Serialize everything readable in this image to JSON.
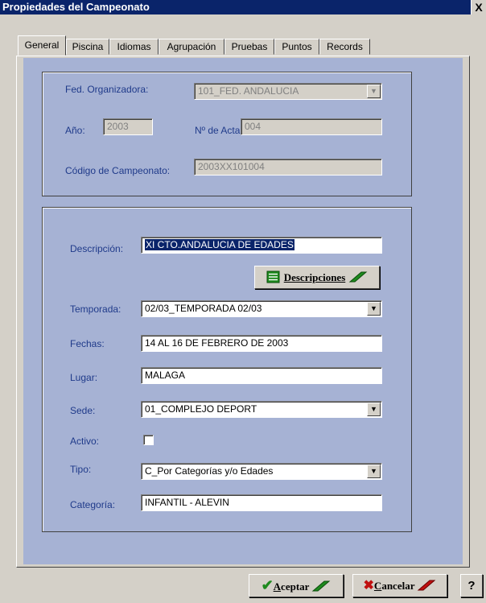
{
  "window": {
    "title": "Propiedades del Campeonato",
    "close": "X"
  },
  "tabs": [
    "General",
    "Piscina",
    "Idiomas",
    "Agrupación",
    "Pruebas",
    "Puntos",
    "Records"
  ],
  "top": {
    "fed_label": "Fed. Organizadora:",
    "fed_value": "101_FED. ANDALUCIA",
    "anio_label": "Año:",
    "anio_value": "2003",
    "acta_label": "Nº de Acta:",
    "acta_value": "004",
    "codigo_label": "Código de Campeonato:",
    "codigo_value": "2003XX101004"
  },
  "main": {
    "descripcion_label": "Descripción:",
    "descripcion_value": "XI CTO.ANDALUCIA DE EDADES",
    "descripciones_button": "Descripciones",
    "temporada_label": "Temporada:",
    "temporada_value": "02/03_TEMPORADA 02/03",
    "fechas_label": "Fechas:",
    "fechas_value": "14 AL 16 DE FEBRERO DE 2003",
    "lugar_label": "Lugar:",
    "lugar_value": "MALAGA",
    "sede_label": "Sede:",
    "sede_value": "01_COMPLEJO DEPORT",
    "activo_label": "Activo:",
    "activo_checked": false,
    "tipo_label": "Tipo:",
    "tipo_value": "C_Por Categorías y/o Edades",
    "categoria_label": "Categoría:",
    "categoria_value": "INFANTIL - ALEVIN"
  },
  "buttons": {
    "aceptar_first": "A",
    "aceptar_rest": "ceptar",
    "cancelar_first": "C",
    "cancelar_rest": "ancelar",
    "help": "?"
  },
  "colors": {
    "panel": "#a6b2d4",
    "label": "#1f3a8a",
    "titlebar": "#0a246a",
    "accept": "#1e8a1e",
    "cancel": "#c01010"
  }
}
